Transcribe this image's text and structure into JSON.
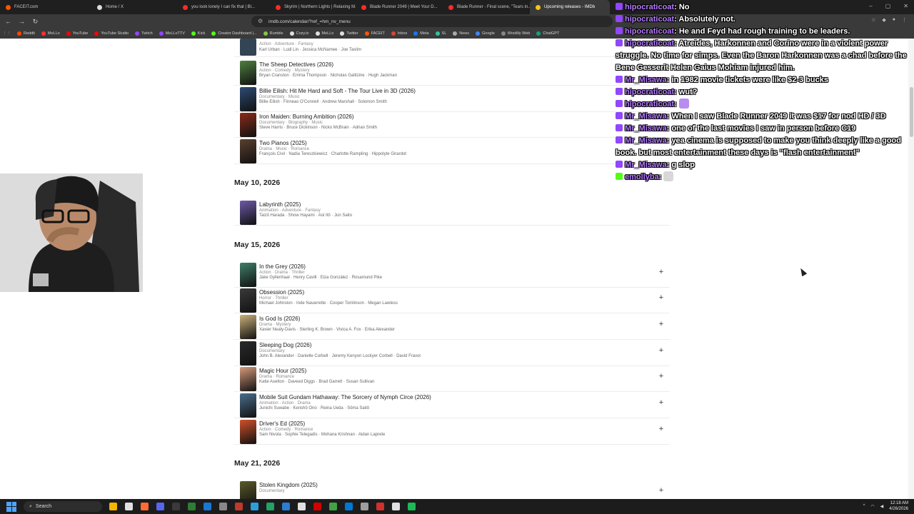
{
  "browser": {
    "tabs": [
      {
        "label": "FACEIT.com",
        "color": "#ff5500"
      },
      {
        "label": "Home / X",
        "color": "#dddddd"
      },
      {
        "label": "you look lonely I can fix that | Bl...",
        "color": "#ff2a2a"
      },
      {
        "label": "Skyrim | Northern Lights | Relaxing M...",
        "color": "#ff2a2a"
      },
      {
        "label": "Blade Runner 2049 | Meet Your D...",
        "color": "#ff2a2a"
      },
      {
        "label": "Blade Runner - Final scene, \"Tears in...",
        "color": "#ff2a2a"
      },
      {
        "label": "Upcoming releases - IMDb",
        "color": "#f5c518"
      }
    ],
    "url": "imdb.com/calendar/?ref_=hm_nv_menu",
    "bookmarks": [
      {
        "label": "Reddit",
        "color": "#ff4500"
      },
      {
        "label": "MeLLo",
        "color": "#ff3030"
      },
      {
        "label": "YouTube",
        "color": "#ff0000"
      },
      {
        "label": "YouTube Studio",
        "color": "#ff0000"
      },
      {
        "label": "Twitch",
        "color": "#9146ff"
      },
      {
        "label": "MeLLoTTV",
        "color": "#9146ff"
      },
      {
        "label": "Kick",
        "color": "#53fc18"
      },
      {
        "label": "Creator Dashboard |...",
        "color": "#53fc18"
      },
      {
        "label": "Rumble",
        "color": "#85c742"
      },
      {
        "label": "Cozy.tv",
        "color": "#e0e0e0"
      },
      {
        "label": "MeLLo",
        "color": "#e0e0e0"
      },
      {
        "label": "Twitter",
        "color": "#e0e0e0"
      },
      {
        "label": "FACEIT",
        "color": "#ff5500"
      },
      {
        "label": "Inbox",
        "color": "#d44638"
      },
      {
        "label": "Meta",
        "color": "#1877f2"
      },
      {
        "label": "SL",
        "color": "#31c3a2"
      },
      {
        "label": "News",
        "color": "#aaaaaa"
      },
      {
        "label": "Google",
        "color": "#4285f4"
      },
      {
        "label": "Woolilly Web",
        "color": "#888888"
      },
      {
        "label": "ChatGPT",
        "color": "#10a37f"
      }
    ]
  },
  "calendar": {
    "partial_top": {
      "genres": "Action · Adventure · Fantasy",
      "cast": "Karl Urban · Ludi Lin · Jessica McNamee · Joe Taslim"
    },
    "sections": [
      {
        "date": "",
        "movies": [
          {
            "title": "The Sheep Detectives (2026)",
            "genres": "Action · Comedy · Mystery",
            "cast": "Bryan Cranston · Emma Thompson · Nicholas Galitzine · Hugh Jackman",
            "poster": "#4f7f3f"
          },
          {
            "title": "Billie Eilish: Hit Me Hard and Soft - The Tour Live in 3D (2026)",
            "genres": "Documentary · Music",
            "cast": "Billie Eilish · Finneas O'Connell · Andrew Marshall · Solomon Smith",
            "poster": "#2d4a73"
          },
          {
            "title": "Iron Maiden: Burning Ambition (2026)",
            "genres": "Documentary · Biography · Music",
            "cast": "Steve Harris · Bruce Dickinson · Nicko McBrain · Adrian Smith",
            "poster": "#8a2b1a"
          },
          {
            "title": "Two Pianos (2025)",
            "genres": "Drama · Music · Romance",
            "cast": "François Civil · Nadia Tereszkiewicz · Charlotte Rampling · Hippolyte Girardot",
            "poster": "#5a4030"
          }
        ]
      },
      {
        "date": "May 10, 2026",
        "movies": [
          {
            "title": "Labyrinth (2025)",
            "genres": "Animation · Adventure · Fantasy",
            "cast": "Taizô Harada · Show Hayami · Aoi Itô · Jun Saito",
            "poster": "#6d5aa8"
          }
        ]
      },
      {
        "date": "May 15, 2026",
        "movies": [
          {
            "title": "In the Grey (2026)",
            "genres": "Action · Drama · Thriller",
            "cast": "Jake Gyllenhaal · Henry Cavill · Eiza González · Rosamund Pike",
            "poster": "#3f7f6a"
          },
          {
            "title": "Obsession (2025)",
            "genres": "Horror · Thriller",
            "cast": "Michael Johnston · Inde Navarrette · Cooper Tomlinson · Megan Lawless",
            "poster": "#3a3a3a"
          },
          {
            "title": "Is God Is (2026)",
            "genres": "Drama · Mystery",
            "cast": "Xavier Nealy-Davis · Sterling K. Brown · Vivica A. Fox · Erika Alexander",
            "poster": "#c9b07a"
          },
          {
            "title": "Sleeping Dog (2026)",
            "genres": "Documentary",
            "cast": "John B. Alexander · Danielle Corbell · Jeremy Kenyon Lockyer Corbell · David Fravor",
            "poster": "#2a2a2a"
          },
          {
            "title": "Magic Hour (2025)",
            "genres": "Drama · Romance",
            "cast": "Katie Aselton · Daveed Diggs · Brad Garrett · Susan Sullivan",
            "poster": "#d49a7a"
          },
          {
            "title": "Mobile Suit Gundam Hathaway: The Sorcery of Nymph Circe (2026)",
            "genres": "Animation · Action · Drama",
            "cast": "Junichi Suwabe · Kenshô Ono · Reina Ueda · Sôma Saitô",
            "poster": "#4a6d8c"
          },
          {
            "title": "Driver's Ed (2025)",
            "genres": "Action · Comedy · Romance",
            "cast": "Sam Nivola · Sophie Telegadis · Mohana Krishnan · Aidan Laprete",
            "poster": "#d0502a"
          }
        ]
      },
      {
        "date": "May 21, 2026",
        "movies": [
          {
            "title": "Stolen Kingdom (2025)",
            "genres": "Documentary",
            "cast": "",
            "poster": "#5a5a2a"
          }
        ]
      }
    ]
  },
  "chat": {
    "messages": [
      {
        "user": "hipocraticoat",
        "text": "No",
        "badge": "twitch",
        "emote": ""
      },
      {
        "user": "hipocraticoat",
        "text": "Absolutely not.",
        "badge": "twitch",
        "emote": ""
      },
      {
        "user": "hipocraticoat",
        "text": "He and Feyd had rough training to be leaders.",
        "badge": "twitch",
        "emote": ""
      },
      {
        "user": "hipocraticoat",
        "text": "Atreides, Harkonnen and Corino were in a violent power struggle. No time for simps. Even the Baron Harkonnen was a chad before the Bene Gesserit Helen Gaius Mohiam injured him.",
        "badge": "twitch",
        "emote": ""
      },
      {
        "user": "Mr_Misawa",
        "text": "in 1982 movie tickets were like $2-3 bucks",
        "badge": "twitch",
        "emote": ""
      },
      {
        "user": "hipocraticoat",
        "text": "wut?",
        "badge": "twitch",
        "emote": ""
      },
      {
        "user": "hipocraticoat",
        "text": "",
        "badge": "twitch",
        "emote": "#b98cf0"
      },
      {
        "user": "Mr_Misawa",
        "text": "When I saw Blade Runner 2049 it was $17 for nod HD / 3D",
        "badge": "twitch",
        "emote": ""
      },
      {
        "user": "Mr_Misawa",
        "text": "one of the last movies I saw in person before C19",
        "badge": "twitch",
        "emote": ""
      },
      {
        "user": "Mr_Misawa",
        "text": "yea cinema is supposed to make you think deeply like a good book. but most entertainment these days is \"flash entertainment\"",
        "badge": "twitch",
        "emote": ""
      },
      {
        "user": "Mr_Misawa",
        "text": "g slop",
        "badge": "twitch",
        "emote": ""
      },
      {
        "user": "emollyba",
        "text": "",
        "badge": "kick",
        "emote": "#d8d8d8"
      }
    ]
  },
  "taskbar": {
    "search_label": "Search",
    "time": "12:18 AM",
    "date": "4/26/2026",
    "apps": [
      "#f4b400",
      "#e0e0e0",
      "#ff6b35",
      "#5865f2",
      "#3a3a3a",
      "#2e7d32",
      "#1976d2",
      "#888888",
      "#c0392b",
      "#2d9cdb",
      "#21a366",
      "#2b7cd3",
      "#e0e0e0",
      "#d40000",
      "#43a047",
      "#0078d4",
      "#9e9e9e",
      "#d32f2f",
      "#e0e0e0",
      "#1db954"
    ]
  }
}
